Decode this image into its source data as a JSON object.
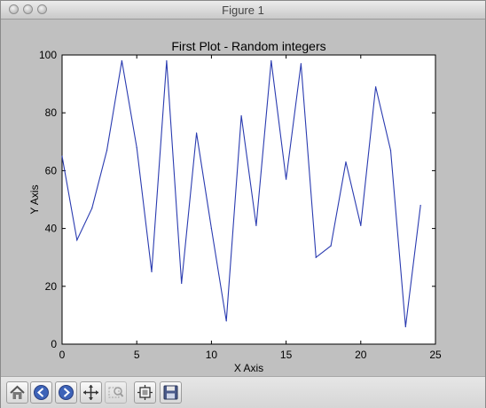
{
  "window": {
    "title": "Figure 1"
  },
  "toolbar": {
    "buttons": [
      {
        "name": "home-button",
        "icon": "home-icon"
      },
      {
        "name": "back-button",
        "icon": "back-arrow-icon"
      },
      {
        "name": "forward-button",
        "icon": "forward-arrow-icon"
      },
      {
        "name": "pan-button",
        "icon": "pan-arrows-icon"
      },
      {
        "name": "zoom-button",
        "icon": "zoom-rect-icon"
      },
      {
        "name": "configure-subplots-button",
        "icon": "subplots-icon"
      },
      {
        "name": "save-button",
        "icon": "save-disk-icon"
      }
    ]
  },
  "chart_data": {
    "type": "line",
    "title": "First Plot - Random integers",
    "xlabel": "X Axis",
    "ylabel": "Y Axis",
    "xlim": [
      0,
      25
    ],
    "ylim": [
      0,
      100
    ],
    "xticks": [
      0,
      5,
      10,
      15,
      20,
      25
    ],
    "yticks": [
      0,
      20,
      40,
      60,
      80,
      100
    ],
    "grid": false,
    "line_color": "#2a3bb0",
    "x": [
      0,
      1,
      2,
      3,
      4,
      5,
      6,
      7,
      8,
      9,
      10,
      11,
      12,
      13,
      14,
      15,
      16,
      17,
      18,
      19,
      20,
      21,
      22,
      23,
      24
    ],
    "values": [
      65,
      36,
      47,
      67,
      98,
      68,
      25,
      98,
      21,
      73,
      40,
      8,
      79,
      41,
      98,
      57,
      97,
      30,
      34,
      63,
      41,
      89,
      67,
      6,
      48
    ]
  }
}
